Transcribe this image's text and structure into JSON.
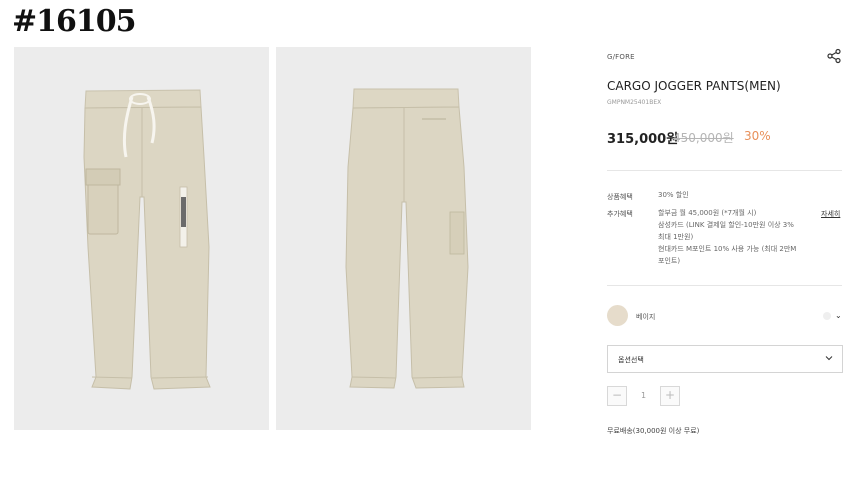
{
  "badge": "#16105",
  "images": [
    {
      "alt": "front",
      "color": "#dcd6c4"
    },
    {
      "alt": "back",
      "color": "#dcd6c4"
    }
  ],
  "product": {
    "brand": "G/FORE",
    "title": "CARGO JOGGER PANTS(MEN)",
    "code": "GMPNM25401BEX",
    "price": "315,000원",
    "original_price": "450,000원",
    "discount": "30%"
  },
  "benefits": {
    "product_label": "상품혜택",
    "product_value": "30% 할인",
    "extra_label": "추가혜택",
    "extra_lines": [
      "할부금 월 45,000원 (*7개월 시)",
      "삼성카드 (LINK 결제일 할인-10만원 이상 3%",
      "최대 1만원)",
      "현대카드 M포인트 10% 사용 가능 (최대 2만M",
      "포인트)"
    ],
    "more_link": "자세히"
  },
  "color": {
    "name": "베이지",
    "swatch": "#e6dccb"
  },
  "option_select": {
    "label": "옵션선택"
  },
  "quantity": {
    "minus": "−",
    "value": "1",
    "plus": "+"
  },
  "shipping": "무료배송(30,000원 이상 무료)",
  "colors": {
    "discount": "#e8905a",
    "original_price": "#b5b5b5"
  }
}
